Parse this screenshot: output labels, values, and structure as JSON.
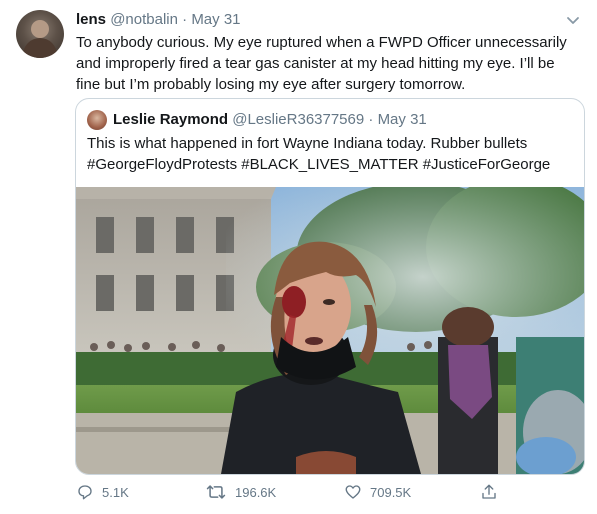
{
  "tweet": {
    "author_name": "lens",
    "author_handle": "@notbalin",
    "separator": "·",
    "date": "May 31",
    "text": "To anybody curious. My eye ruptured when a FWPD Officer unnecessarily\nand improperly fired a tear gas canister at my head hitting my eye. I’ll be\nfine but I’m probably losing my eye after surgery tomorrow."
  },
  "quoted": {
    "author_name": "Leslie Raymond",
    "author_handle": "@LeslieR36377569",
    "separator": "·",
    "date": "May 31",
    "text": "This is what happened in fort Wayne Indiana today. Rubber bullets\n#GeorgeFloydProtests #BLACK_LIVES_MATTER #JusticeForGeorge"
  },
  "actions": {
    "replies": "5.1K",
    "retweets": "196.6K",
    "likes": "709.5K"
  },
  "icons": {
    "menu": "chevron-down-icon",
    "reply": "reply-icon",
    "retweet": "retweet-icon",
    "like": "heart-icon",
    "share": "share-icon"
  },
  "colors": {
    "text": "#14171a",
    "muted": "#657786",
    "border": "#ccd6dd"
  }
}
